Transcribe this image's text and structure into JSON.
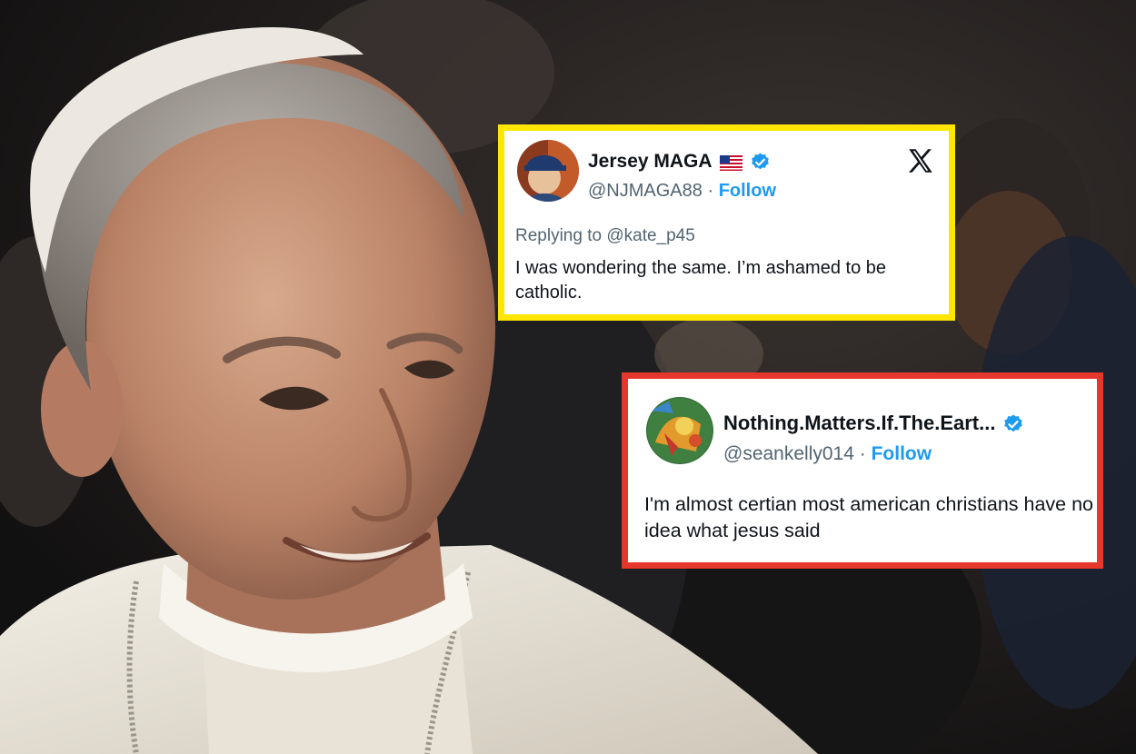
{
  "tweets": [
    {
      "display_name": "Jersey MAGA",
      "handle": "@NJMAGA88",
      "separator": "·",
      "follow_label": "Follow",
      "replying_prefix": "Replying to",
      "replying_to": "@kate_p45",
      "body": "I was wondering the same. I’m ashamed to be catholic.",
      "border_color": "#ffe600"
    },
    {
      "display_name": "Nothing.Matters.If.The.Eart...",
      "handle": "@seankelly014",
      "separator": "·",
      "follow_label": "Follow",
      "body": "I'm almost certian most american christians have no idea what jesus said",
      "border_color": "#e5372b"
    }
  ],
  "colors": {
    "link": "#1d9bf0",
    "verified": "#1d9bf0",
    "text_primary": "#0f1419",
    "text_secondary": "#536471"
  },
  "icons": [
    "x-logo-icon",
    "verified-badge-icon",
    "us-flag-icon",
    "avatar"
  ]
}
